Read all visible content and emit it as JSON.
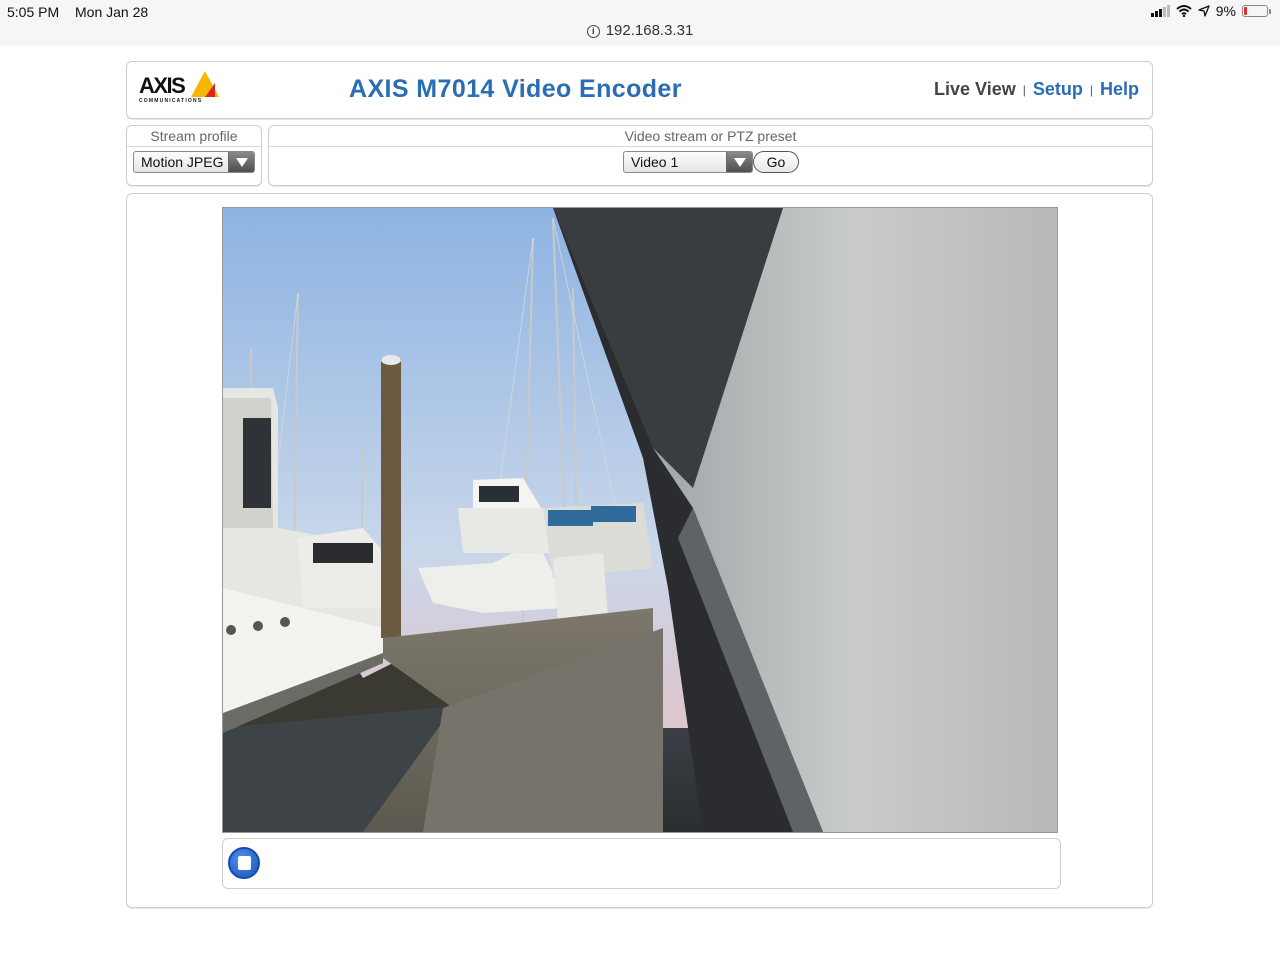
{
  "status_bar": {
    "time": "5:05 PM",
    "date": "Mon Jan 28",
    "battery": "9%",
    "icons": [
      "signal-icon",
      "wifi-icon",
      "location-icon",
      "battery-icon"
    ]
  },
  "address_bar": {
    "url": "192.168.3.31",
    "icon": "info-icon"
  },
  "header": {
    "logo_text": "AXIS",
    "logo_subtext": "COMMUNICATIONS",
    "title": "AXIS M7014 Video Encoder",
    "nav": {
      "live_view": "Live View",
      "separator": "|",
      "setup": "Setup",
      "help": "Help"
    }
  },
  "stream_profile": {
    "label": "Stream profile",
    "selected": "Motion JPEG"
  },
  "preset": {
    "label": "Video stream or PTZ preset",
    "selected": "Video 1",
    "go_label": "Go"
  },
  "video": {
    "content": "live-camera-feed"
  },
  "colors": {
    "accent": "#2a6db5",
    "logo_yellow": "#f5b800",
    "logo_red": "#e0251b",
    "stop_button": "#1a5fd0"
  }
}
